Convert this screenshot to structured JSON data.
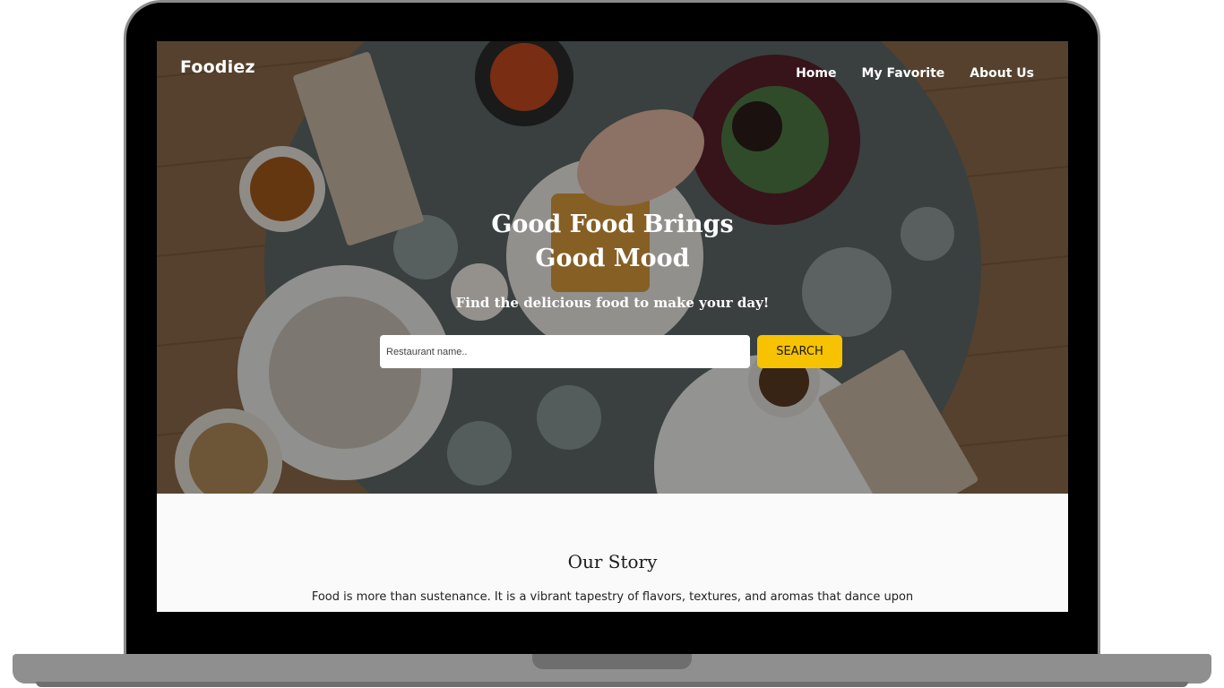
{
  "header": {
    "brand": "Foodiez",
    "nav": {
      "home": "Home",
      "favorite": "My Favorite",
      "about": "About Us"
    }
  },
  "hero": {
    "title_line1": "Good Food Brings",
    "title_line2": "Good Mood",
    "subtitle": "Find the delicious food to make your day!",
    "search": {
      "placeholder": "Restaurant name..",
      "button_label": "SEARCH"
    }
  },
  "story": {
    "title": "Our Story",
    "text": "Food is more than sustenance. It is a vibrant tapestry of flavors, textures, and aromas that dance upon"
  },
  "colors": {
    "accent": "#f7c200",
    "bezel": "#000000",
    "frame": "#8f8f8f"
  }
}
